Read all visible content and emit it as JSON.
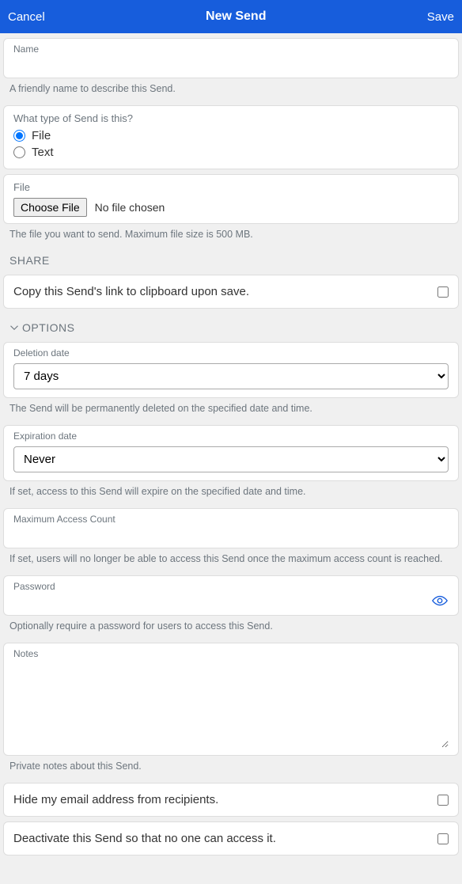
{
  "header": {
    "cancel": "Cancel",
    "title": "New Send",
    "save": "Save"
  },
  "name": {
    "label": "Name",
    "value": "",
    "help": "A friendly name to describe this Send."
  },
  "type": {
    "question": "What type of Send is this?",
    "file": "File",
    "text": "Text"
  },
  "file": {
    "label": "File",
    "choose": "Choose File",
    "status": "No file chosen",
    "help": "The file you want to send. Maximum file size is 500 MB."
  },
  "share": {
    "header": "SHARE",
    "copyLabel": "Copy this Send's link to clipboard upon save."
  },
  "options": {
    "header": "OPTIONS"
  },
  "deletion": {
    "label": "Deletion date",
    "value": "7 days",
    "help": "The Send will be permanently deleted on the specified date and time."
  },
  "expiration": {
    "label": "Expiration date",
    "value": "Never",
    "help": "If set, access to this Send will expire on the specified date and time."
  },
  "maxAccess": {
    "label": "Maximum Access Count",
    "value": "",
    "help": "If set, users will no longer be able to access this Send once the maximum access count is reached."
  },
  "password": {
    "label": "Password",
    "value": "",
    "help": "Optionally require a password for users to access this Send."
  },
  "notes": {
    "label": "Notes",
    "value": "",
    "help": "Private notes about this Send."
  },
  "hideEmail": {
    "label": "Hide my email address from recipients."
  },
  "deactivate": {
    "label": "Deactivate this Send so that no one can access it."
  }
}
